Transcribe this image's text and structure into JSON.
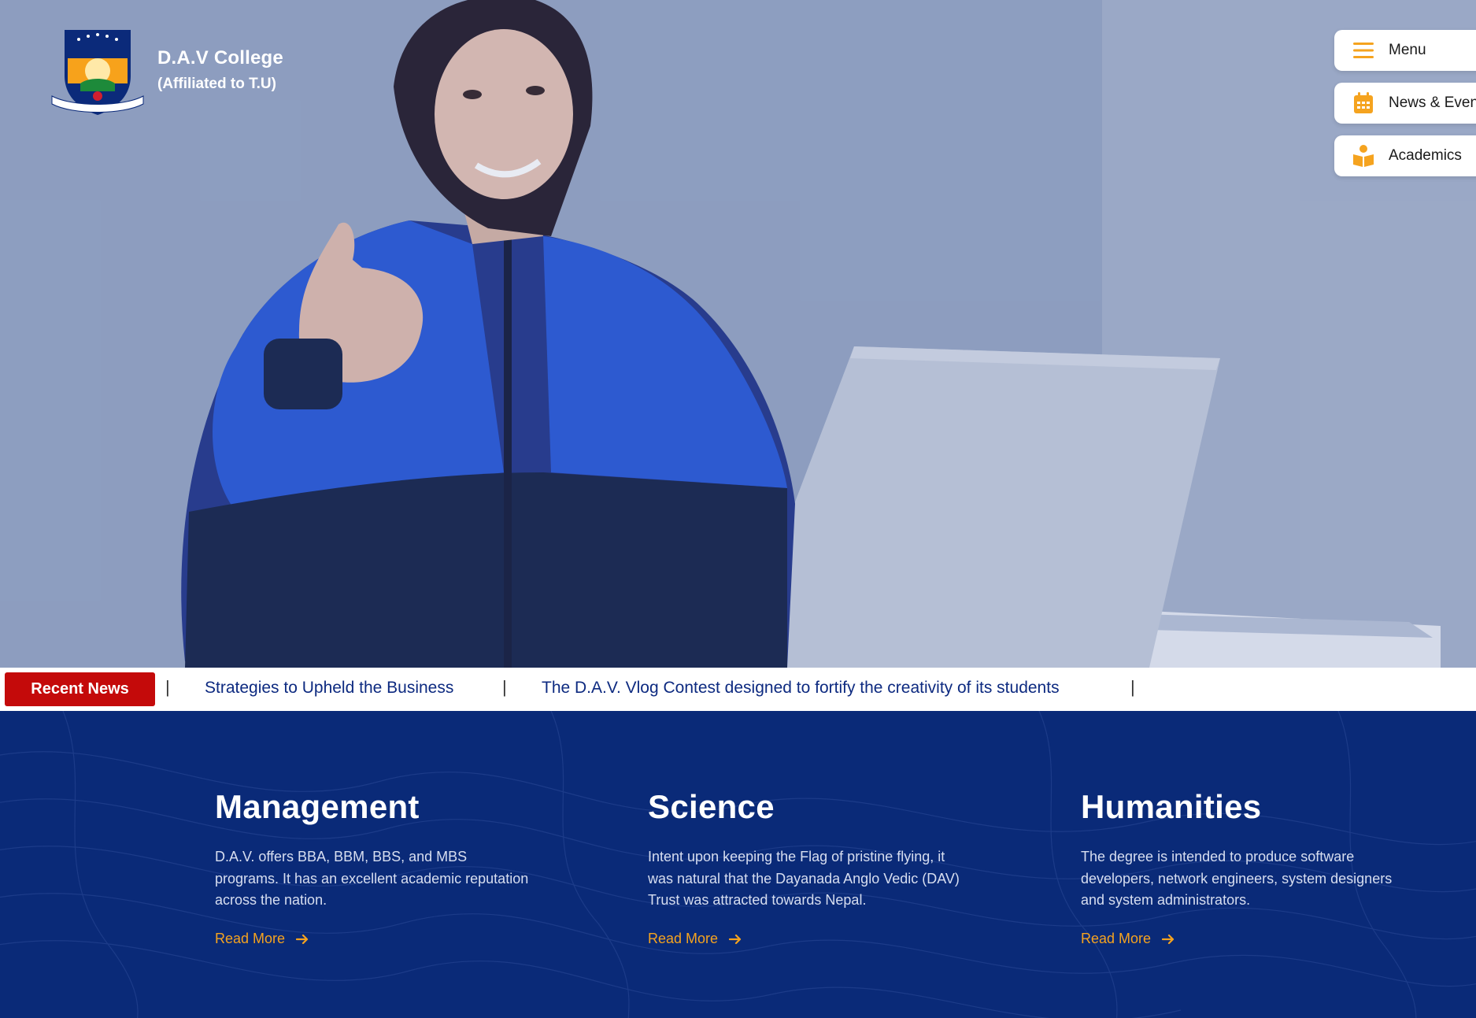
{
  "brand": {
    "name": "D.A.V College",
    "subtitle": "(Affiliated to T.U)",
    "logo_icon": "college-crest-icon"
  },
  "side_nav": [
    {
      "label": "Menu",
      "icon": "hamburger-icon"
    },
    {
      "label": "News & Events",
      "icon": "calendar-icon"
    },
    {
      "label": "Academics",
      "icon": "reading-icon"
    }
  ],
  "ticker": {
    "badge": "Recent News",
    "separator": "|",
    "items": [
      "Strategies to Upheld the Business",
      "The D.A.V. Vlog Contest designed to fortify the creativity of its students"
    ]
  },
  "programs": [
    {
      "title": "Management",
      "description": "D.A.V. offers BBA, BBM, BBS, and MBS programs. It has an excellent academic reputation across the nation.",
      "link": "Read More"
    },
    {
      "title": "Science",
      "description": "Intent upon keeping the Flag of pristine flying, it was natural that the Dayanada Anglo Vedic (DAV) Trust was attracted towards Nepal.",
      "link": "Read More"
    },
    {
      "title": "Humanities",
      "description": "The degree is intended to produce software developers, network engineers, system designers and system administrators.",
      "link": "Read More"
    }
  ],
  "colors": {
    "navy": "#0a2a78",
    "accent_orange": "#f5a31f",
    "badge_red": "#c40a0a",
    "ticker_text": "#0d2a80"
  }
}
